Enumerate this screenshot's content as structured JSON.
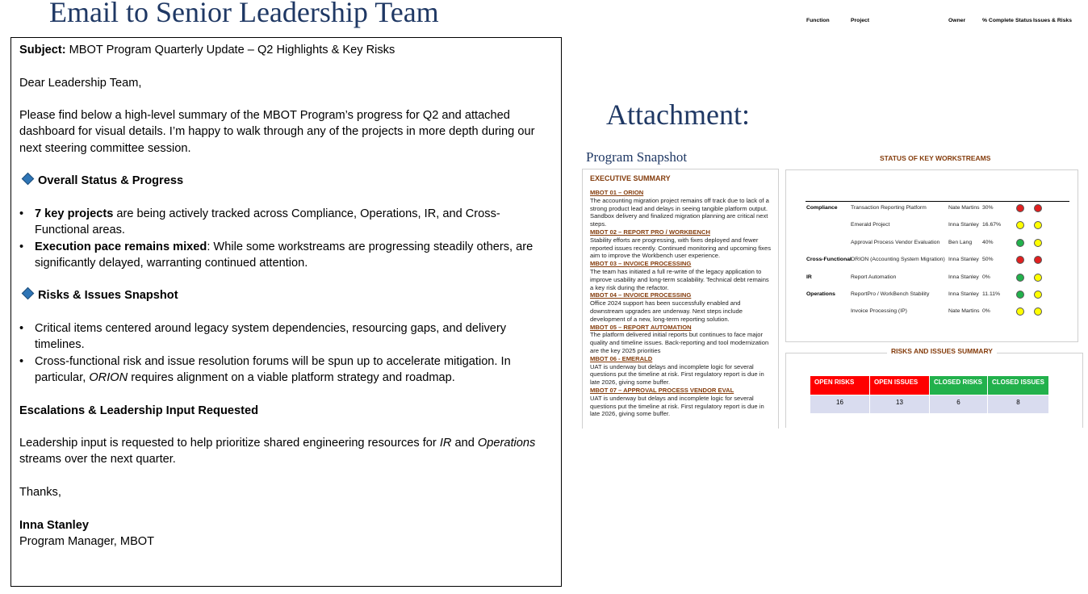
{
  "page": {
    "title": "Email to Senior Leadership Team",
    "attachment_title": "Attachment:"
  },
  "email": {
    "subject_label": "Subject:",
    "subject": "MBOT Program Quarterly Update – Q2 Highlights & Key Risks",
    "greeting": "Dear Leadership Team,",
    "intro": "Please find below a high-level summary of the MBOT Program’s progress for Q2 and attached dashboard for visual details. I’m happy to walk through any of the projects in more depth during our next steering committee session.",
    "section1_heading": "Overall Status & Progress",
    "section1_bullets": [
      {
        "bold": "7 key projects",
        "text": " are being actively tracked across Compliance, Operations, IR, and Cross-Functional areas."
      },
      {
        "bold": "Execution pace remains mixed",
        "text": ": While some workstreams are progressing steadily others, are significantly delayed, warranting continued attention."
      }
    ],
    "section2_heading": "Risks & Issues Snapshot",
    "section2_bullets": [
      {
        "text": "Critical items centered around legacy system dependencies, resourcing gaps, and delivery timelines."
      },
      {
        "pre": "Cross-functional risk and issue resolution forums will be spun up to accelerate mitigation.  In particular, ",
        "italic": "ORION",
        "post": " requires alignment on a viable platform strategy and roadmap."
      }
    ],
    "section3_heading": "Escalations & Leadership Input Requested",
    "leadership": {
      "pre": "Leadership input is requested to help prioritize shared engineering resources for ",
      "ir": "IR",
      "mid": " and ",
      "ops": "Operations",
      "post": " streams over the next quarter."
    },
    "closing": "Thanks,",
    "signature_name": "Inna Stanley",
    "signature_title": "Program Manager, MBOT"
  },
  "dashboard": {
    "title": "Program Snapshot",
    "exec_summary": {
      "heading": "EXECUTIVE SUMMARY",
      "items": [
        {
          "title": "MBOT 01 – ORION",
          "text": "The accounting migration project remains off track due to lack of a strong product lead and delays in seeing tangible platform output. Sandbox delivery and finalized migration planning are critical next steps."
        },
        {
          "title": "MBOT 02 – REPORT PRO / WORKBENCH",
          "text": "Stability efforts are progressing, with fixes deployed and fewer reported issues recently. Continued monitoring and upcoming fixes aim to improve the Workbench user experience."
        },
        {
          "title": "MBOT 03 – INVOICE PROCESSING",
          "text": "The team has initiated a full re-write of the legacy application to improve usability and long-term scalability. Technical debt remains a key risk during the refactor."
        },
        {
          "title": "MBOT 04 – INVOICE PROCESSING",
          "text": "Office 2024 support has been successfully enabled and downstream upgrades are underway. Next steps include development of a new, long-term reporting solution."
        },
        {
          "title": "MBOT 05 – REPORT AUTOMATION",
          "text": "The platform delivered initial reports but continues to face major quality and timeline issues. Back-reporting and tool modernization are the key 2025 priorities"
        },
        {
          "title": "MBOT 06 - EMERALD",
          "text": "UAT is underway but delays and incomplete logic for several questions put the timeline at risk. First regulatory report is due in late 2026, giving some buffer."
        },
        {
          "title": "MBOT 07 – APPROVAL PROCESS VENDOR EVAL",
          "text": "UAT is underway but delays and incomplete logic for several questions put the timeline at risk. First regulatory report is due in late 2026, giving some buffer."
        }
      ]
    },
    "workstreams": {
      "heading": "STATUS OF KEY WORKSTREAMS",
      "columns": {
        "function": "Function",
        "project": "Project",
        "owner": "Owner",
        "complete": "% Complete",
        "status": "Status",
        "issues": "Issues & Risks"
      },
      "rows": [
        {
          "function": "Compliance",
          "project": "Transaction Reporting Platform",
          "owner": "Nate Martins",
          "complete": "30%",
          "status_color": "#e02020",
          "issues_color": "#e02020"
        },
        {
          "function": "",
          "project": "Emerald Project",
          "owner": "Inna Stanley",
          "complete": "16.67%",
          "status_color": "#ffff00",
          "issues_color": "#ffff00"
        },
        {
          "function": "",
          "project": "Approval Process Vendor Evaluation",
          "owner": "Ben Lang",
          "complete": "40%",
          "status_color": "#22b14c",
          "issues_color": "#ffff00"
        },
        {
          "function": "Cross-Functional",
          "project": "ORION (Accounting System Migration)",
          "owner": "Inna Stanley",
          "complete": "50%",
          "status_color": "#e02020",
          "issues_color": "#e02020"
        },
        {
          "function": "IR",
          "project": "Report Automation",
          "owner": "Inna Stanley",
          "complete": "0%",
          "status_color": "#22b14c",
          "issues_color": "#ffff00"
        },
        {
          "function": "Operations",
          "project": "ReportPro / WorkBench Stability",
          "owner": "Inna Stanley",
          "complete": "11.11%",
          "status_color": "#22b14c",
          "issues_color": "#ffff00"
        },
        {
          "function": "",
          "project": "Invoice Processing (IP)",
          "owner": "Nate Martins",
          "complete": "0%",
          "status_color": "#ffff00",
          "issues_color": "#ffff00"
        }
      ]
    },
    "risks_issues": {
      "heading": "RISKS AND ISSUES SUMMARY",
      "cells": [
        {
          "label": "OPEN RISKS",
          "value": "16",
          "color": "#ff0000"
        },
        {
          "label": "OPEN ISSUES",
          "value": "13",
          "color": "#ff0000"
        },
        {
          "label": "CLOSED RISKS",
          "value": "6",
          "color": "#22b14c"
        },
        {
          "label": "CLOSED ISSUES",
          "value": "8",
          "color": "#22b14c"
        }
      ]
    }
  }
}
